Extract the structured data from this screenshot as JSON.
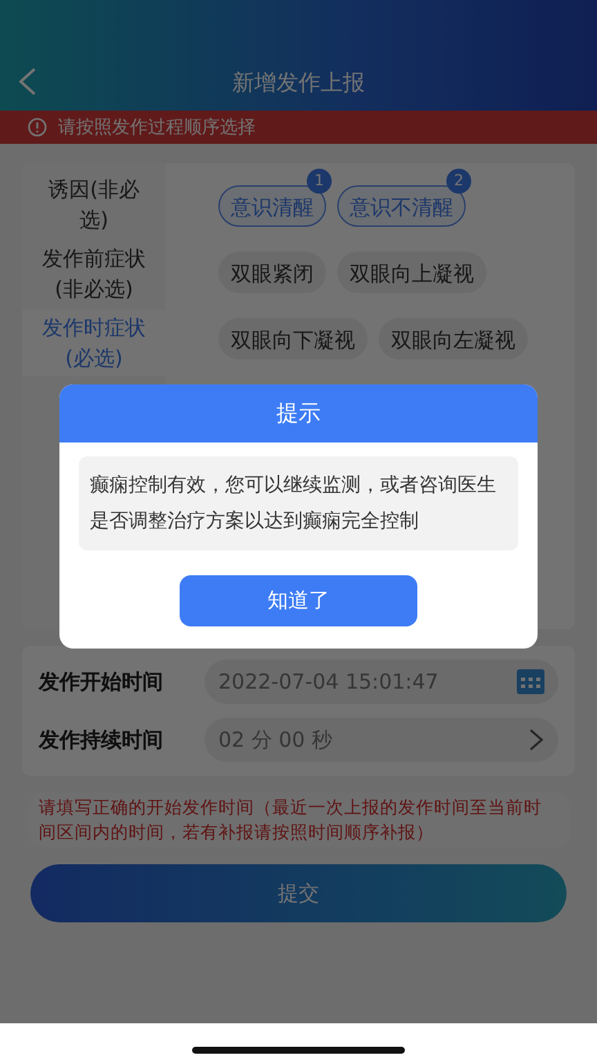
{
  "header": {
    "title": "新增发作上报"
  },
  "notice": "请按照发作过程顺序选择",
  "categories": [
    {
      "label": "诱因(非必选)",
      "selected": false
    },
    {
      "label": "发作前症状(非必选)",
      "selected": false
    },
    {
      "label": "发作时症状(必选)",
      "selected": true
    }
  ],
  "chips": [
    {
      "label": "意识清醒",
      "selected": true,
      "badge": "1"
    },
    {
      "label": "意识不清醒",
      "selected": true,
      "badge": "2"
    },
    {
      "label": "双眼紧闭",
      "selected": false
    },
    {
      "label": "双眼向上凝视",
      "selected": false
    },
    {
      "label": "双眼向下凝视",
      "selected": false
    },
    {
      "label": "双眼向左凝视",
      "selected": false
    }
  ],
  "start_time": {
    "label": "发作开始时间",
    "value": "2022-07-04 15:01:47"
  },
  "duration": {
    "label": "发作持续时间",
    "value": "02 分 00 秒"
  },
  "warning": "请填写正确的开始发作时间（最近一次上报的发作时间至当前时间区间内的时间，若有补报请按照时间顺序补报）",
  "submit": "提交",
  "dialog": {
    "title": "提示",
    "message": "癫痫控制有效，您可以继续监测，或者咨询医生是否调整治疗方案以达到癫痫完全控制",
    "button": "知道了"
  }
}
